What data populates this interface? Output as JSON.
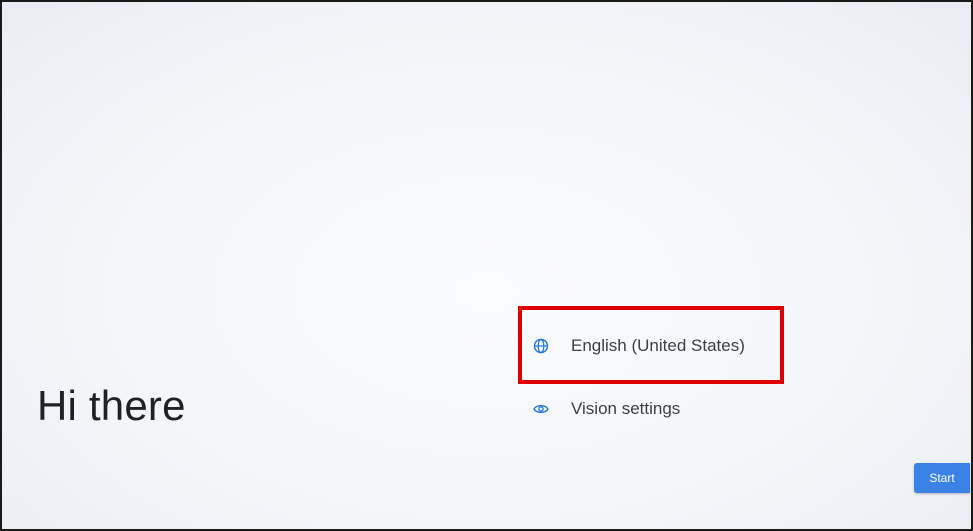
{
  "welcome": {
    "title": "Hi there"
  },
  "options": {
    "language": {
      "label": "English (United States)",
      "icon": "globe-icon"
    },
    "vision": {
      "label": "Vision settings",
      "icon": "eye-icon"
    }
  },
  "start_button": {
    "label": "Start"
  },
  "colors": {
    "accent": "#3b82e6",
    "highlight": "#e00000",
    "text": "#202124"
  }
}
